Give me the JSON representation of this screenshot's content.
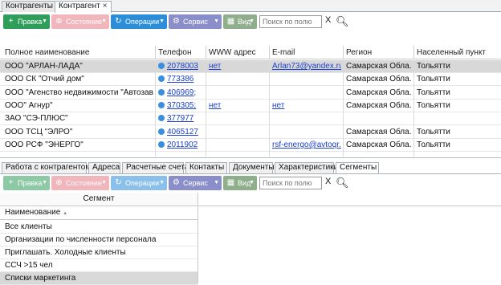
{
  "window_tabs": [
    {
      "label": "Контрагенты"
    },
    {
      "label": "Контрагент",
      "close": "×"
    }
  ],
  "toolbar": {
    "pravka": "Правка",
    "sostoyanie": "Состояние",
    "operacii": "Операции",
    "servis": "Сервис",
    "vid": "Вид",
    "search_placeholder": "Поиск по полю",
    "clear": "X"
  },
  "table": {
    "columns": [
      "Полное наименование",
      "Телефон",
      "WWW адрес",
      "E-mail",
      "Регион",
      "Населенный пункт"
    ],
    "rows": [
      {
        "name": "ООО \"АРЛАН-ЛАДА\"",
        "phone": "2078003",
        "www": "нет",
        "email": "Arlan73@yandex.ru",
        "region": "Самарская Обла...",
        "city": "Тольятти"
      },
      {
        "name": "ООО СК \"Отчий дом\"",
        "phone": "773386",
        "www": "",
        "email": "",
        "region": "Самарская Обла...",
        "city": "Тольятти"
      },
      {
        "name": "ООО \"Агенство недвижимости \"Автозав...",
        "phone": "406969;",
        "www": "",
        "email": "",
        "region": "Самарская Обла...",
        "city": "Тольятти"
      },
      {
        "name": "ООО\" Агнур\"",
        "phone": "370305;",
        "www": "нет",
        "email": "нет",
        "region": "Самарская Обла...",
        "city": "Тольятти"
      },
      {
        "name": "ЗАО \"СЭ-ПЛЮС\"",
        "phone": "377977",
        "www": "",
        "email": "",
        "region": "",
        "city": ""
      },
      {
        "name": "ООО ТСЦ \"ЭЛРО\"",
        "phone": "4065127",
        "www": "",
        "email": "",
        "region": "Самарская Обла...",
        "city": "Тольятти"
      },
      {
        "name": "ООО РСФ \"ЭНЕРГО\"",
        "phone": "2011902",
        "www": "",
        "email": "rsf-energo@avtoqr...",
        "region": "Самарская Обла...",
        "city": "Тольятти"
      }
    ]
  },
  "detail_tabs": [
    "Работа с контрагентом",
    "Адреса",
    "Расчетные счета",
    "Контакты",
    "Документы",
    "Характеристики",
    "Сегменты"
  ],
  "segments": {
    "title": "Сегмент",
    "column": "Наименование",
    "sort_indicator": "▲",
    "items": [
      "Все клиенты",
      "Организации по численности персонала",
      "Приглашать. Холодные клиенты",
      "ССЧ >15 чел",
      "Списки маркетинга"
    ]
  }
}
